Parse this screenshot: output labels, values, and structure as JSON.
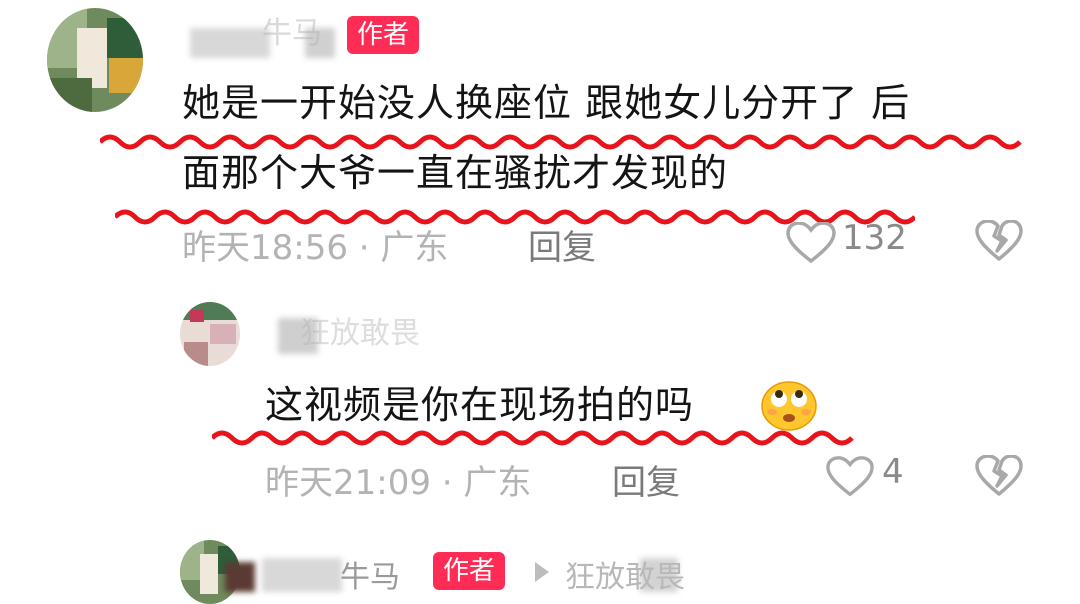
{
  "comments": [
    {
      "username": "牛马",
      "badge": "作者",
      "text_line1": "她是一开始没人换座位 跟她女儿分开了 后",
      "text_line2": "面那个大爷一直在骚扰才发现的",
      "time_location": "昨天18:56 · 广东",
      "reply_label": "回复",
      "likes": "132"
    },
    {
      "username": "狂放敢畏",
      "text": "这视频是你在现场拍的吗",
      "emoji": "eye-roll-emoji",
      "time_location": "昨天21:09 · 广东",
      "reply_label": "回复",
      "likes": "4"
    },
    {
      "username": "牛马",
      "badge": "作者",
      "reply_to": "狂放敢畏"
    }
  ],
  "colors": {
    "badge": "#ff2d55",
    "underline": "#e8141c"
  },
  "icons": [
    "heart-outline-icon",
    "broken-heart-icon",
    "play-arrow-icon"
  ]
}
